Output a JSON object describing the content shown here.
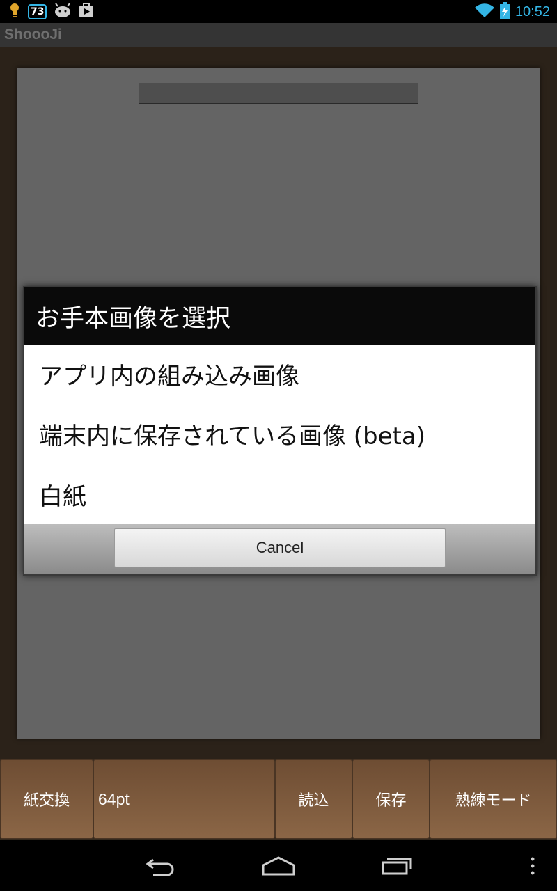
{
  "status_bar": {
    "notification_count": "73",
    "time": "10:52",
    "icons": [
      "lightbulb-icon",
      "notification-count-icon",
      "android-icon",
      "play-store-icon",
      "wifi-icon",
      "battery-charging-icon"
    ]
  },
  "app": {
    "title": "ShoooJi"
  },
  "dialog": {
    "title": "お手本画像を選択",
    "items": [
      {
        "label": "アプリ内の組み込み画像"
      },
      {
        "label": "端末内に保存されている画像 (beta)"
      },
      {
        "label": "白紙"
      }
    ],
    "cancel_label": "Cancel"
  },
  "toolbar": {
    "paper_change": "紙交換",
    "size": "64pt",
    "load": "読込",
    "save": "保存",
    "expert_mode": "熟練モード"
  },
  "navbar": {
    "icons": [
      "back-icon",
      "home-icon",
      "recent-apps-icon",
      "menu-icon"
    ]
  },
  "colors": {
    "accent": "#34b5e5",
    "wood": "#7b5a3d",
    "paper": "#646464",
    "dialog_title_bg": "#0a0a0a"
  }
}
